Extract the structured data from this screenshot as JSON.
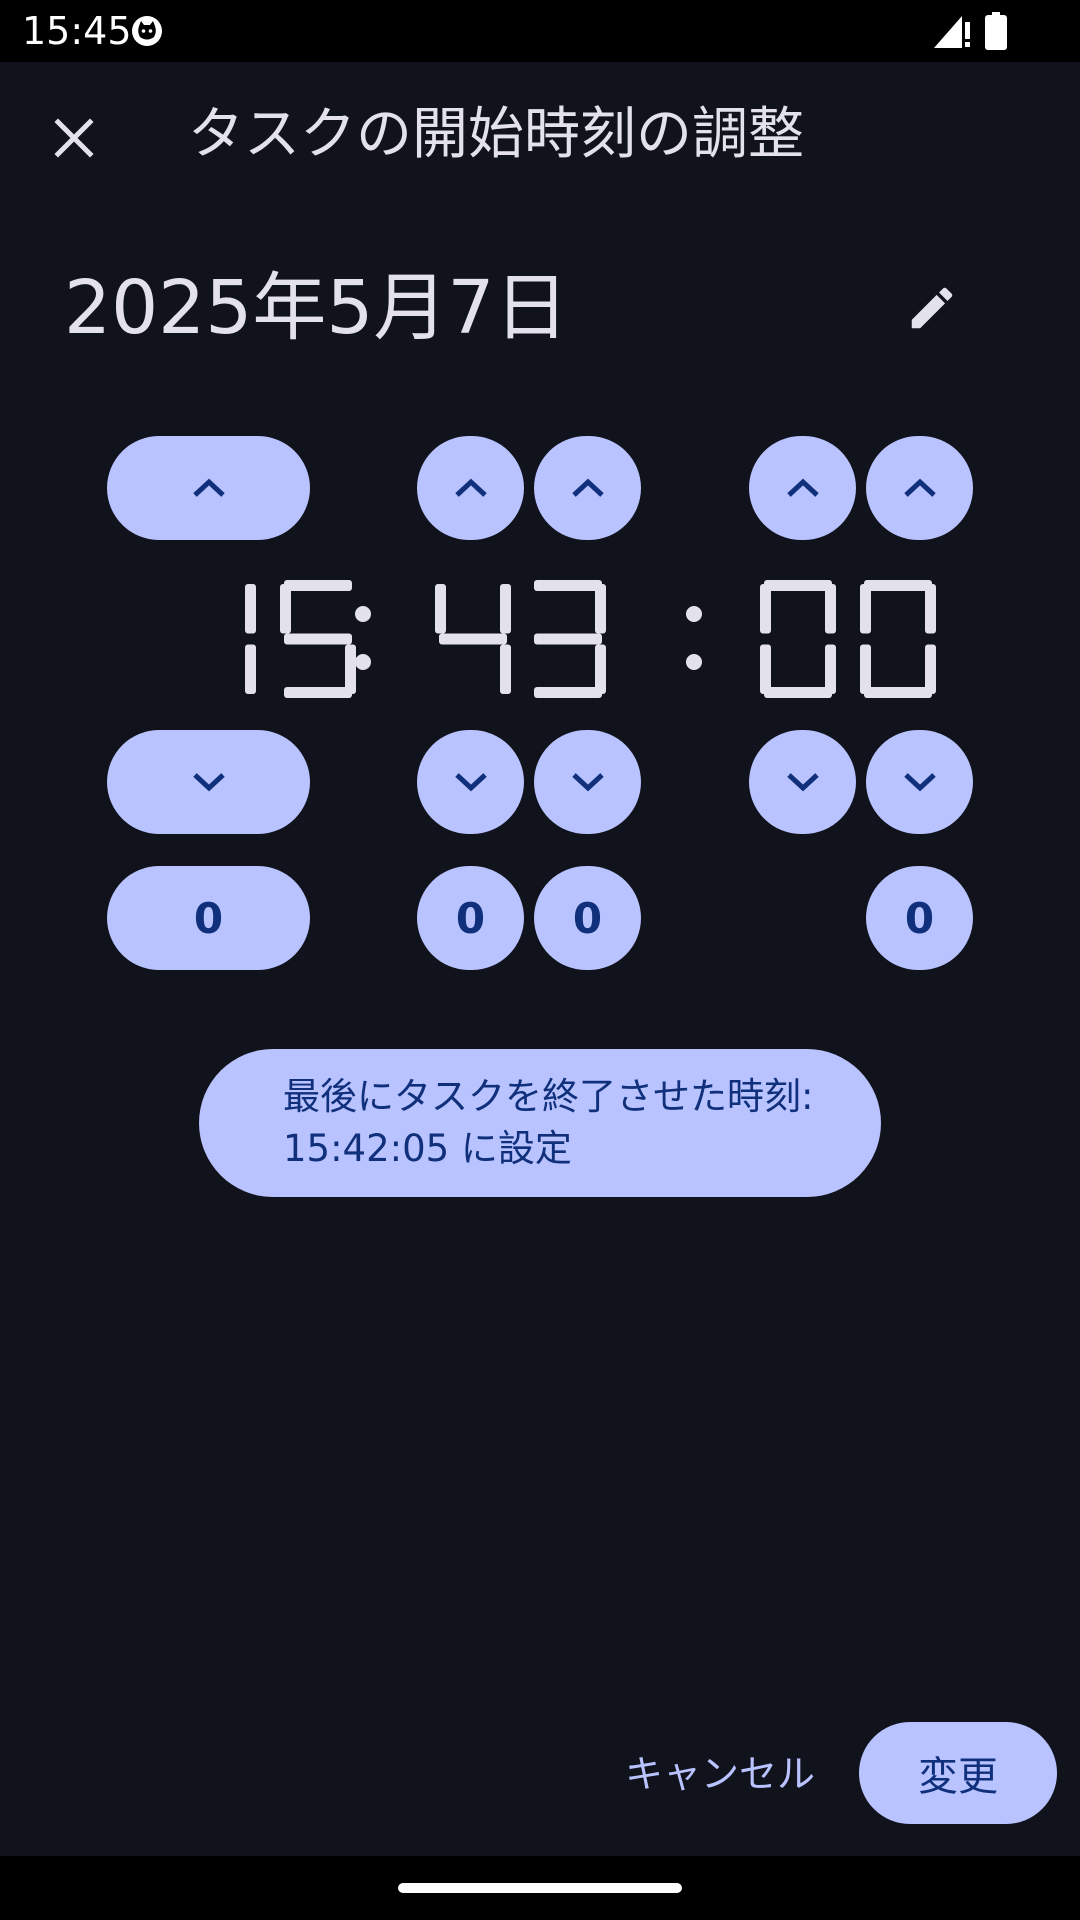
{
  "status_bar": {
    "time": "15:45"
  },
  "app_bar": {
    "title": "タスクの開始時刻の調整",
    "close_icon": "close-icon"
  },
  "date": {
    "value": "2025年5月7日",
    "edit_icon": "pencil-icon"
  },
  "time": {
    "hours": "15",
    "minutes": "43",
    "seconds": "00",
    "separator": ":"
  },
  "reset_buttons": {
    "hours": "0",
    "minutes_tens": "0",
    "minutes_ones": "0",
    "seconds": "0"
  },
  "hint": {
    "line1": "最後にタスクを終了させた時刻:",
    "line2": "15:42:05 に設定"
  },
  "actions": {
    "cancel": "キャンセル",
    "confirm": "変更"
  },
  "colors": {
    "background": "#11131c",
    "accent": "#b9c3ff",
    "on_accent": "#10307c",
    "text": "#e3e2ea"
  }
}
